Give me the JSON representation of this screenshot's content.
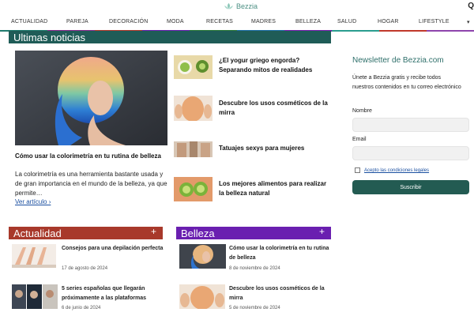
{
  "header": {
    "brand": "Bezzia"
  },
  "nav": {
    "items": [
      "ACTUALIDAD",
      "PAREJA",
      "DECORACIÓN",
      "MODA",
      "RECETAS",
      "MADRES",
      "BELLEZA",
      "SALUD",
      "HOGAR",
      "LIFESTYLE",
      "▾"
    ],
    "underline_colors": [
      "#1f7a6d",
      "#8a2b8f",
      "#b63a2b",
      "#6a1fb0",
      "#2d7a3a",
      "#1f6fa8",
      "#7a1fb0",
      "#2a9d8f",
      "#c0392b",
      "#8e44ad"
    ]
  },
  "latest": {
    "section_title": "Ultimas noticias",
    "section_color": "#1f5c57",
    "feature": {
      "title": "Cómo usar la colorimetría en tu rutina de belleza",
      "excerpt": "La colorimetría es una herramienta bastante usada y de gran importancia en el mundo de la belleza, ya que permite…",
      "link": "Ver artículo ›"
    },
    "side": [
      {
        "title": "¿El yogur griego engorda? Separando mitos de realidades",
        "icon": "yogurt-thumb"
      },
      {
        "title": "Descubre los usos cosméticos de la mirra",
        "icon": "face-mask-thumb"
      },
      {
        "title": "Tatuajes sexys para mujeres",
        "icon": "tattoo-thumb"
      },
      {
        "title": "Los mejores alimentos para realizar la belleza natural",
        "icon": "kiwi-thumb"
      }
    ]
  },
  "newsletter": {
    "title": "Newsletter de Bezzia.com",
    "text": "Únete a Bezzia gratis y recibe todos nuestros contenidos en tu correo electrónico",
    "name_label": "Nombre",
    "email_label": "Email",
    "legal": "Acepto las condiciones legales",
    "button": "Suscribir"
  },
  "actualidad": {
    "section_title": "Actualidad",
    "color": "#a8392b",
    "plus": "+",
    "items": [
      {
        "title": "Consejos para una depilación perfecta",
        "date": "17 de agosto de 2024"
      },
      {
        "title": "5 series españolas que llegarán próximamente a las plataformas",
        "date": "6 de junio de 2024"
      }
    ]
  },
  "belleza": {
    "section_title": "Belleza",
    "color": "#6a1fb0",
    "plus": "+",
    "items": [
      {
        "title": "Cómo usar la colorimetría en tu rutina de belleza",
        "date": "8 de noviembre de 2024"
      },
      {
        "title": "Descubre los usos cosméticos de la mirra",
        "date": "5 de noviembre de 2024"
      }
    ]
  }
}
